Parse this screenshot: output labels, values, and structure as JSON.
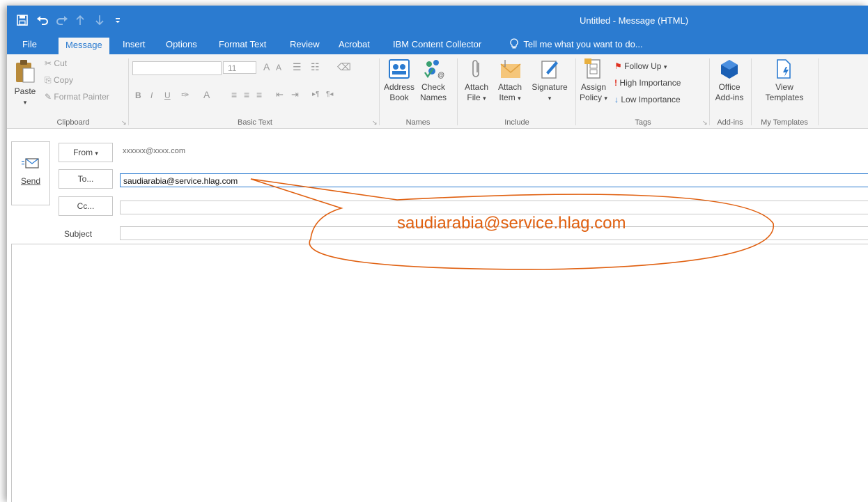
{
  "window": {
    "title": "Untitled - Message (HTML)"
  },
  "quick_access": {
    "save_icon": "save-icon",
    "undo_icon": "undo-icon",
    "redo_icon": "redo-icon",
    "up_icon": "arrow-up-icon",
    "down_icon": "arrow-down-icon",
    "customize_icon": "customize-icon"
  },
  "tabs": [
    {
      "label": "File"
    },
    {
      "label": "Message"
    },
    {
      "label": "Insert"
    },
    {
      "label": "Options"
    },
    {
      "label": "Format Text"
    },
    {
      "label": "Review"
    },
    {
      "label": "Acrobat"
    },
    {
      "label": "IBM Content Collector"
    }
  ],
  "tellme": {
    "label": "Tell me what you want to do..."
  },
  "ribbon": {
    "clipboard": {
      "paste": "Paste",
      "cut": "Cut",
      "copy": "Copy",
      "format_painter": "Format Painter",
      "group": "Clipboard"
    },
    "basic_text": {
      "font_size": "11",
      "group": "Basic Text"
    },
    "names": {
      "address_book": [
        "Address",
        "Book"
      ],
      "check_names": [
        "Check",
        "Names"
      ],
      "group": "Names"
    },
    "include": {
      "attach_file": [
        "Attach",
        "File"
      ],
      "attach_item": [
        "Attach",
        "Item"
      ],
      "signature": "Signature",
      "group": "Include"
    },
    "tags": {
      "assign_policy": [
        "Assign",
        "Policy"
      ],
      "follow_up": "Follow Up",
      "high_importance": "High Importance",
      "low_importance": "Low Importance",
      "group": "Tags"
    },
    "addins": {
      "office_addins": [
        "Office",
        "Add-ins"
      ],
      "group": "Add-ins"
    },
    "templates": {
      "view_templates": [
        "View",
        "Templates"
      ],
      "group": "My Templates"
    }
  },
  "compose": {
    "send": "Send",
    "from_label": "From",
    "from_value": "xxxxxx@xxxx.com",
    "to_label": "To...",
    "to_value": "saudiarabia@service.hlag.com",
    "cc_label": "Cc...",
    "cc_value": "",
    "subject_label": "Subject",
    "subject_value": ""
  },
  "callout": {
    "text": "saudiarabia@service.hlag.com",
    "color": "#e06010"
  },
  "colors": {
    "accent": "#2b7bd0"
  }
}
